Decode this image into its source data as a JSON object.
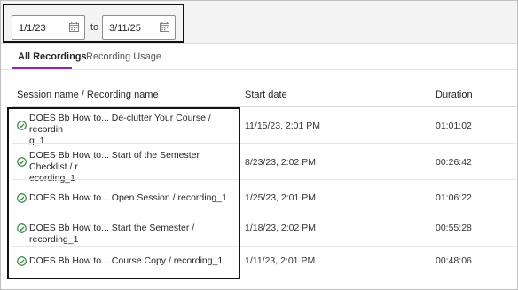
{
  "filters": {
    "start_date": "1/1/23",
    "to_label": "to",
    "end_date": "3/11/25"
  },
  "tabs": [
    {
      "label": "All Recordings",
      "active": true
    },
    {
      "label": "Recording Usage",
      "active": false
    }
  ],
  "table": {
    "headers": [
      "Session name / Recording name",
      "Start date",
      "Duration"
    ],
    "rows": [
      {
        "name_line1": "DOES Bb How to... De-clutter Your Course / recordin",
        "name_line2": "g_1",
        "start_date": "11/15/23, 2:01 PM",
        "duration": "01:01:02",
        "status": "check-circle-icon"
      },
      {
        "name_line1": "DOES Bb How to... Start of the Semester Checklist / r",
        "name_line2": "ecording_1",
        "start_date": "8/23/23, 2:02 PM",
        "duration": "00:26:42",
        "status": "check-circle-icon"
      },
      {
        "name_line1": "DOES Bb How to... Open Session / recording_1",
        "name_line2": "",
        "start_date": "1/25/23, 2:01 PM",
        "duration": "01:06:22",
        "status": "check-circle-icon"
      },
      {
        "name_line1": "DOES Bb How to... Start the Semester / recording_1",
        "name_line2": "",
        "start_date": "1/18/23, 2:02 PM",
        "duration": "00:55:28",
        "status": "check-circle-icon"
      },
      {
        "name_line1": "DOES Bb How to... Course Copy / recording_1",
        "name_line2": "",
        "start_date": "1/11/23, 2:01 PM",
        "duration": "00:48:06",
        "status": "check-circle-icon"
      }
    ]
  },
  "colors": {
    "accent_tab": "#8a2da4",
    "success_check": "#2e8540"
  }
}
